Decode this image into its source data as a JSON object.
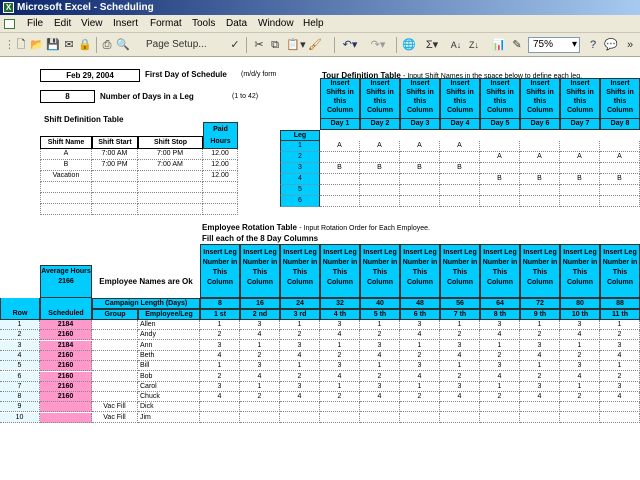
{
  "window": {
    "title": "Microsoft Excel - Scheduling"
  },
  "menu": [
    "File",
    "Edit",
    "View",
    "Insert",
    "Format",
    "Tools",
    "Data",
    "Window",
    "Help"
  ],
  "toolbar": {
    "page_setup": "Page Setup...",
    "zoom": "75%"
  },
  "schedule": {
    "first_day_value": "Feb 29, 2004",
    "first_day_label": "First Day of Schedule",
    "first_day_hint": "(m/d/y form",
    "num_days_value": "8",
    "num_days_label": "Number of Days in a Leg",
    "num_days_hint": "(1 to 42)"
  },
  "shift_table": {
    "title": "Shift Definition Table",
    "headers": [
      "Shift Name",
      "Shift Start",
      "Shift Stop",
      "Paid Hours"
    ],
    "rows": [
      [
        "A",
        "7:00 AM",
        "7:00 PM",
        "12.00"
      ],
      [
        "B",
        "7:00 PM",
        "7:00 AM",
        "12.00"
      ],
      [
        "Vacation",
        "",
        "",
        "12.00"
      ],
      [
        "",
        "",
        "",
        ""
      ],
      [
        "",
        "",
        "",
        ""
      ],
      [
        "",
        "",
        "",
        ""
      ]
    ]
  },
  "tour_table": {
    "title": "Tour Definition Table",
    "instructions": "- Input Shift Names in the space below to define each leg.",
    "insert_header": "Insert Shifts in this Column",
    "leg_header": "Leg",
    "days": [
      "Day 1",
      "Day 2",
      "Day 3",
      "Day 4",
      "Day 5",
      "Day 6",
      "Day 7",
      "Day 8"
    ],
    "legs": [
      "1",
      "2",
      "3",
      "4",
      "5",
      "6"
    ],
    "cells": [
      [
        "A",
        "A",
        "A",
        "A",
        "",
        "",
        "",
        ""
      ],
      [
        "",
        "",
        "",
        "",
        "A",
        "A",
        "A",
        "A"
      ],
      [
        "B",
        "B",
        "B",
        "B",
        "",
        "",
        "",
        ""
      ],
      [
        "",
        "",
        "",
        "",
        "B",
        "B",
        "B",
        "B"
      ],
      [
        "",
        "",
        "",
        "",
        "",
        "",
        "",
        ""
      ],
      [
        "",
        "",
        "",
        "",
        "",
        "",
        "",
        ""
      ]
    ]
  },
  "rotation": {
    "title": "Employee Rotation Table",
    "instructions": "- Input Rotation Order for Each Employee.",
    "subtitle": "Fill each of the 8 Day Columns",
    "insert_header": "Insert Leg Number in This Column",
    "average_label": "Average Hours",
    "average_value": "2166",
    "employee_names_label": "Employee Names are Ok",
    "campaign_label": "Campaign Length (Days)",
    "col_headers": [
      "Row Number",
      "Scheduled Hours",
      "Group",
      "Employee/Leg"
    ],
    "campaign_days": [
      "8",
      "16",
      "24",
      "32",
      "40",
      "48",
      "56",
      "64",
      "72",
      "80",
      "88"
    ],
    "leg_ordinals": [
      "1 st",
      "2 nd",
      "3 rd",
      "4 th",
      "5 th",
      "6 th",
      "7 th",
      "8 th",
      "9 th",
      "10 th",
      "11 th"
    ],
    "rows": [
      {
        "num": "1",
        "hours": "2184",
        "group": "",
        "name": "Allen",
        "legs": [
          "1",
          "3",
          "1",
          "3",
          "1",
          "3",
          "1",
          "3",
          "1",
          "3",
          "1"
        ]
      },
      {
        "num": "2",
        "hours": "2160",
        "group": "",
        "name": "Andy",
        "legs": [
          "2",
          "4",
          "2",
          "4",
          "2",
          "4",
          "2",
          "4",
          "2",
          "4",
          "2"
        ]
      },
      {
        "num": "3",
        "hours": "2184",
        "group": "",
        "name": "Ann",
        "legs": [
          "3",
          "1",
          "3",
          "1",
          "3",
          "1",
          "3",
          "1",
          "3",
          "1",
          "3"
        ]
      },
      {
        "num": "4",
        "hours": "2160",
        "group": "",
        "name": "Beth",
        "legs": [
          "4",
          "2",
          "4",
          "2",
          "4",
          "2",
          "4",
          "2",
          "4",
          "2",
          "4"
        ]
      },
      {
        "num": "5",
        "hours": "2160",
        "group": "",
        "name": "Bill",
        "legs": [
          "1",
          "3",
          "1",
          "3",
          "1",
          "3",
          "1",
          "3",
          "1",
          "3",
          "1"
        ]
      },
      {
        "num": "6",
        "hours": "2160",
        "group": "",
        "name": "Bob",
        "legs": [
          "2",
          "4",
          "2",
          "4",
          "2",
          "4",
          "2",
          "4",
          "2",
          "4",
          "2"
        ]
      },
      {
        "num": "7",
        "hours": "2160",
        "group": "",
        "name": "Carol",
        "legs": [
          "3",
          "1",
          "3",
          "1",
          "3",
          "1",
          "3",
          "1",
          "3",
          "1",
          "3"
        ]
      },
      {
        "num": "8",
        "hours": "2160",
        "group": "",
        "name": "Chuck",
        "legs": [
          "4",
          "2",
          "4",
          "2",
          "4",
          "2",
          "4",
          "2",
          "4",
          "2",
          "4"
        ]
      },
      {
        "num": "9",
        "hours": "",
        "group": "Vac Fill",
        "name": "Dick",
        "legs": [
          "",
          "",
          "",
          "",
          "",
          "",
          "",
          "",
          "",
          "",
          ""
        ]
      },
      {
        "num": "10",
        "hours": "",
        "group": "Vac Fill",
        "name": "Jim",
        "legs": [
          "",
          "",
          "",
          "",
          "",
          "",
          "",
          "",
          "",
          "",
          ""
        ]
      }
    ]
  }
}
